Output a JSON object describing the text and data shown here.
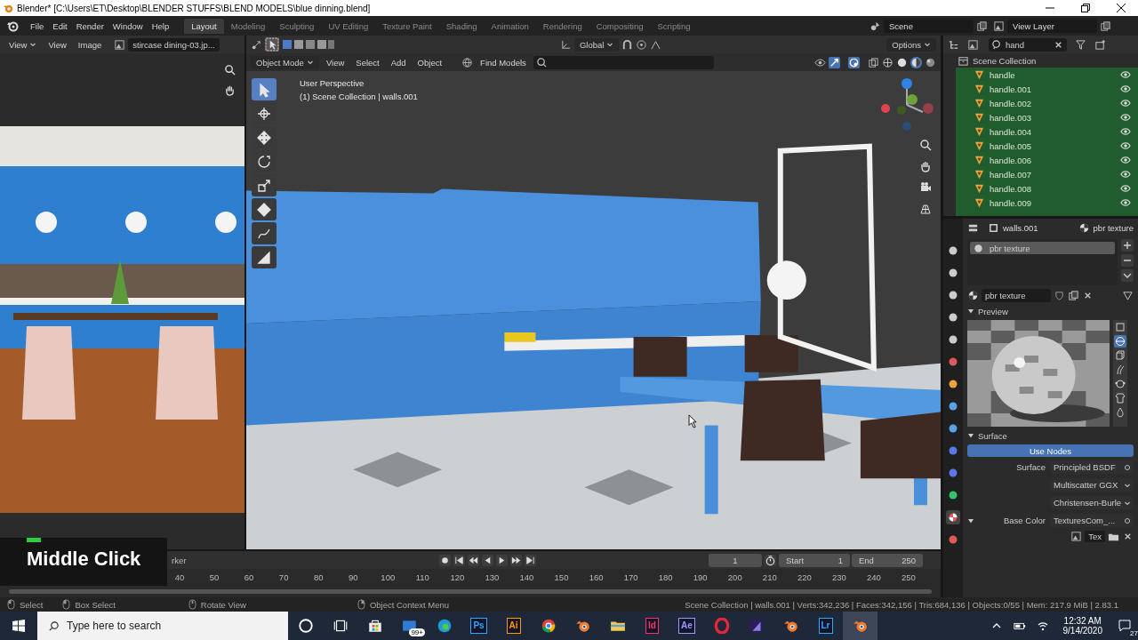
{
  "window": {
    "title": "Blender* [C:\\Users\\ET\\Desktop\\BLENDER STUFFS\\BLEND MODELS\\blue dinning.blend]"
  },
  "menu": [
    "File",
    "Edit",
    "Render",
    "Window",
    "Help"
  ],
  "workspaces": [
    {
      "label": "Layout",
      "selected": true
    },
    {
      "label": "Modeling",
      "selected": false
    },
    {
      "label": "Sculpting",
      "selected": false
    },
    {
      "label": "UV Editing",
      "selected": false
    },
    {
      "label": "Texture Paint",
      "selected": false
    },
    {
      "label": "Shading",
      "selected": false
    },
    {
      "label": "Animation",
      "selected": false
    },
    {
      "label": "Rendering",
      "selected": false
    },
    {
      "label": "Compositing",
      "selected": false
    },
    {
      "label": "Scripting",
      "selected": false
    }
  ],
  "scene": "Scene",
  "view_layer": "View Layer",
  "image_editor": {
    "mode": "View",
    "menus": [
      "View",
      "Image"
    ],
    "image_name": "stircase dining-03.jp..."
  },
  "viewport": {
    "orientation": "Global",
    "options": "Options",
    "mode": "Object Mode",
    "menus": [
      "View",
      "Select",
      "Add",
      "Object"
    ],
    "find_models": "Find Models",
    "perspective": "User Perspective",
    "collection_info": "(1) Scene Collection | walls.001",
    "tools": [
      {
        "kind": "select",
        "selected": true
      },
      {
        "kind": "cursor",
        "selected": false
      },
      {
        "kind": "move",
        "selected": false
      },
      {
        "kind": "rotate",
        "selected": false
      },
      {
        "kind": "scale",
        "selected": false
      },
      {
        "kind": "transform",
        "selected": false
      },
      {
        "kind": "annotate",
        "selected": false
      },
      {
        "kind": "measure",
        "selected": false
      }
    ],
    "shading_modes": [
      {
        "kind": "wireframe",
        "selected": false
      },
      {
        "kind": "solid",
        "selected": false
      },
      {
        "kind": "material",
        "selected": true
      },
      {
        "kind": "rendered",
        "selected": false
      }
    ]
  },
  "overlay_key": "Middle Click",
  "outliner": {
    "search": "hand",
    "root": "Scene Collection",
    "items": [
      {
        "name": "handle",
        "visible": true
      },
      {
        "name": "handle.001",
        "visible": true
      },
      {
        "name": "handle.002",
        "visible": true
      },
      {
        "name": "handle.003",
        "visible": true
      },
      {
        "name": "handle.004",
        "visible": true
      },
      {
        "name": "handle.005",
        "visible": true
      },
      {
        "name": "handle.006",
        "visible": true
      },
      {
        "name": "handle.007",
        "visible": true
      },
      {
        "name": "handle.008",
        "visible": true
      },
      {
        "name": "handle.009",
        "visible": true
      }
    ]
  },
  "properties": {
    "object": "walls.001",
    "material": "pbr texture",
    "tabs": [
      {
        "kind": "tool",
        "selected": false
      },
      {
        "kind": "render",
        "selected": false
      },
      {
        "kind": "output",
        "selected": false
      },
      {
        "kind": "viewlayer",
        "selected": false
      },
      {
        "kind": "scene",
        "selected": false
      },
      {
        "kind": "world",
        "selected": false
      },
      {
        "kind": "object",
        "selected": false
      },
      {
        "kind": "modifier",
        "selected": false
      },
      {
        "kind": "particles",
        "selected": false
      },
      {
        "kind": "physics",
        "selected": false
      },
      {
        "kind": "constraints",
        "selected": false
      },
      {
        "kind": "data",
        "selected": false
      },
      {
        "kind": "material",
        "selected": true
      },
      {
        "kind": "texture",
        "selected": false
      }
    ],
    "slots": [
      {
        "name": "pbr texture",
        "selected": true
      }
    ],
    "material_name": "pbr texture",
    "preview_title": "Preview",
    "preview_shapes": [
      {
        "kind": "plane",
        "selected": false
      },
      {
        "kind": "sphere",
        "selected": true
      },
      {
        "kind": "cube",
        "selected": false
      },
      {
        "kind": "hair",
        "selected": false
      },
      {
        "kind": "monkey",
        "selected": false
      },
      {
        "kind": "cloth",
        "selected": false
      },
      {
        "kind": "fluid",
        "selected": false
      }
    ],
    "surface_title": "Surface",
    "use_nodes": "Use Nodes",
    "fields": [
      {
        "label": "Surface",
        "value": "Principled BSDF",
        "kind": "link",
        "expanded": false
      },
      {
        "value": "Multiscatter GGX",
        "kind": "dropdown",
        "expanded": false
      },
      {
        "value": "Christensen-Burle",
        "kind": "dropdown",
        "expanded": false
      },
      {
        "label": "Base Color",
        "value": "TexturesCom_...",
        "kind": "link",
        "expanded": true
      }
    ],
    "texture_tab": "Tex"
  },
  "timeline": {
    "marker_fragment": "rker",
    "frame": "1",
    "start_label": "Start",
    "start": "1",
    "end_label": "End",
    "end": "250",
    "ticks": [
      "40",
      "50",
      "60",
      "70",
      "80",
      "90",
      "100",
      "110",
      "120",
      "130",
      "140",
      "150",
      "160",
      "170",
      "180",
      "190",
      "200",
      "210",
      "220",
      "230",
      "240",
      "250"
    ]
  },
  "status_bar": {
    "hints": [
      {
        "kind": "left",
        "label": "Select"
      },
      {
        "kind": "drag",
        "label": "Box Select"
      },
      {
        "kind": "middle",
        "label": "Rotate View"
      },
      {
        "kind": "right",
        "label": "Object Context Menu"
      }
    ],
    "stats": "Scene Collection | walls.001 | Verts:342,236 | Faces:342,156 | Tris:684,136 | Objects:0/55 | Mem: 217.9 MiB | 2.83.1"
  },
  "taskbar": {
    "search": "Type here to search",
    "apps": [
      {
        "kind": "cortana",
        "active": false
      },
      {
        "kind": "taskview",
        "active": false
      },
      {
        "kind": "store",
        "active": false
      },
      {
        "kind": "mail",
        "label": "99+",
        "active": false
      },
      {
        "kind": "edge",
        "active": false
      },
      {
        "kind": "tile",
        "label": "Ps",
        "color": "#31a8ff",
        "active": false
      },
      {
        "kind": "tile",
        "label": "Ai",
        "color": "#ff9a00",
        "active": false
      },
      {
        "kind": "chrome",
        "active": false
      },
      {
        "kind": "blender",
        "active": false
      },
      {
        "kind": "folder",
        "active": false
      },
      {
        "kind": "tile",
        "label": "Id",
        "color": "#ff3366",
        "active": false
      },
      {
        "kind": "tile",
        "label": "Ae",
        "color": "#9999ff",
        "active": false
      },
      {
        "kind": "opera",
        "active": false
      },
      {
        "kind": "prism",
        "active": false
      },
      {
        "kind": "blender",
        "active": false
      },
      {
        "kind": "tile",
        "label": "Lr",
        "color": "#31a8ff",
        "active": false
      },
      {
        "kind": "blender",
        "active": true
      }
    ],
    "time": "12:32 AM",
    "date": "9/14/2020",
    "notifications": "27"
  }
}
